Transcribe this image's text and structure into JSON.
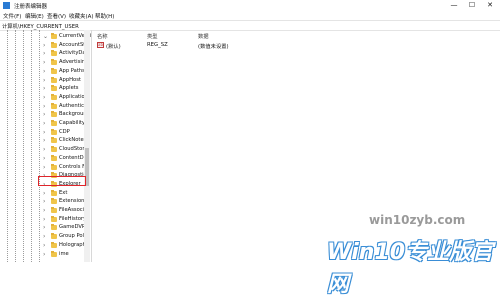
{
  "window": {
    "title": "注册表编辑器",
    "controls": {
      "minimize": "—",
      "maximize": "☐",
      "close": "✕"
    }
  },
  "menu": [
    "文件(F)",
    "编辑(E)",
    "查看(V)",
    "收藏夹(A)",
    "帮助(H)"
  ],
  "address": "计算机\\HKEY_CURRENT_USER",
  "tree": {
    "items": [
      {
        "label": "CurrentVersion",
        "expanded": true
      },
      {
        "label": "AccountSt"
      },
      {
        "label": "ActivityDat"
      },
      {
        "label": "Advertisin"
      },
      {
        "label": "App Paths"
      },
      {
        "label": "AppHost"
      },
      {
        "label": "Applets"
      },
      {
        "label": "Applicatio"
      },
      {
        "label": "Authentica"
      },
      {
        "label": "Backgroun"
      },
      {
        "label": "Capability"
      },
      {
        "label": "CDP"
      },
      {
        "label": "ClickNote"
      },
      {
        "label": "CloudStor"
      },
      {
        "label": "ContentDe"
      },
      {
        "label": "Controls F"
      },
      {
        "label": "Diagnostic"
      },
      {
        "label": "Explorer",
        "highlighted": true
      },
      {
        "label": "Ext"
      },
      {
        "label": "Extensions"
      },
      {
        "label": "FileAssocia"
      },
      {
        "label": "FileHistory"
      },
      {
        "label": "GameDVR"
      },
      {
        "label": "Group Pol"
      },
      {
        "label": "Holograph"
      },
      {
        "label": "ime"
      }
    ]
  },
  "list": {
    "columns": [
      "名称",
      "类型",
      "数据"
    ],
    "rows": [
      {
        "name": "(默认)",
        "type": "REG_SZ",
        "data": "(数值未设置)",
        "icon": "ab"
      }
    ]
  },
  "watermark": {
    "small": "win10zyb.com",
    "big": "Win10专业版官网"
  },
  "colors": {
    "highlight_border": "#e0252b",
    "folder": "#f0c54a"
  }
}
